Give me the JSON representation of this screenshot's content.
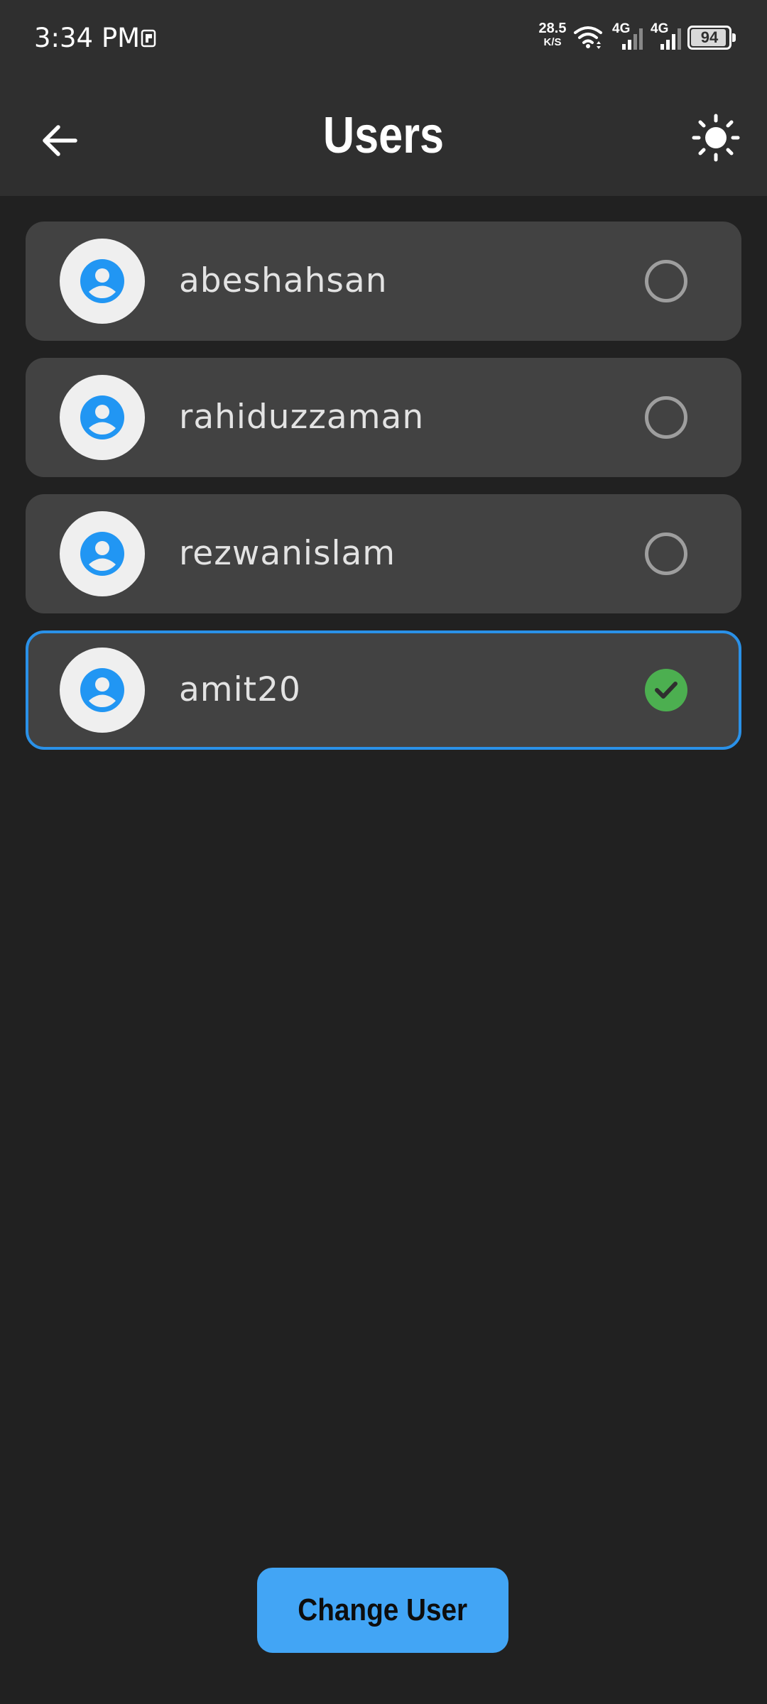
{
  "status_bar": {
    "time": "3:34 PM",
    "net_speed_value": "28.5",
    "net_speed_unit": "K/S",
    "signal_1_label": "4G",
    "signal_2_label": "4G",
    "battery_level": "94",
    "icons": [
      "notification-icon",
      "wifi-icon",
      "signal-icon",
      "battery-icon"
    ]
  },
  "app_bar": {
    "title": "Users",
    "back_icon": "arrow-left-icon",
    "theme_icon": "sun-icon"
  },
  "users": [
    {
      "name": "abeshahsan",
      "selected": false
    },
    {
      "name": "rahiduzzaman",
      "selected": false
    },
    {
      "name": "rezwanislam",
      "selected": false
    },
    {
      "name": "amit20",
      "selected": true
    }
  ],
  "actions": {
    "change_user_label": "Change User"
  },
  "colors": {
    "background": "#212121",
    "app_bar": "#2f2f2f",
    "card": "#424242",
    "accent": "#2a91e8",
    "button": "#42a5f5",
    "check": "#4caf50",
    "avatar_icon": "#2196f3"
  }
}
